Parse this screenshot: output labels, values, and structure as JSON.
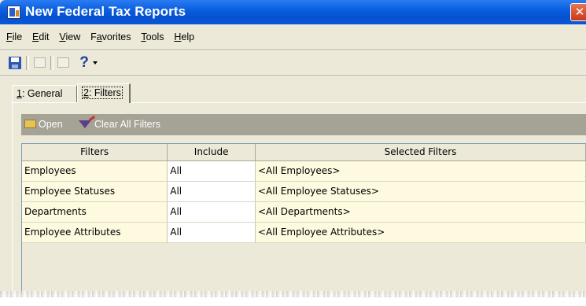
{
  "window": {
    "title": "New Federal Tax Reports",
    "close_glyph": "✕",
    "titlebar_color": "#0a5fe0",
    "body_color": "#ece9d8"
  },
  "menu": [
    {
      "hotkey": "F",
      "rest": "ile"
    },
    {
      "hotkey": "E",
      "rest": "dit"
    },
    {
      "hotkey": "V",
      "rest": "iew"
    },
    {
      "pre": "F",
      "hotkey": "a",
      "rest": "vorites"
    },
    {
      "hotkey": "T",
      "rest": "ools"
    },
    {
      "hotkey": "H",
      "rest": "elp"
    }
  ],
  "toolbar": {
    "help_glyph": "?",
    "icons": [
      "save-icon",
      "disabled-icon",
      "properties-icon",
      "help-icon"
    ]
  },
  "tabs": [
    {
      "hotkey": "1",
      "rest": ": General"
    },
    {
      "hotkey": "2",
      "rest": ": Filters"
    }
  ],
  "actions": {
    "open_label": "Open",
    "clear_label": "Clear All Filters"
  },
  "grid": {
    "columns": [
      "Filters",
      "Include",
      "Selected Filters"
    ],
    "rows": [
      {
        "filter": "Employees",
        "include": "All",
        "selected": "<All Employees>"
      },
      {
        "filter": "Employee Statuses",
        "include": "All",
        "selected": "<All Employee Statuses>"
      },
      {
        "filter": "Departments",
        "include": "All",
        "selected": "<All Departments>"
      },
      {
        "filter": "Employee Attributes",
        "include": "All",
        "selected": "<All Employee Attributes>"
      }
    ],
    "row_color": "#fefae0"
  }
}
